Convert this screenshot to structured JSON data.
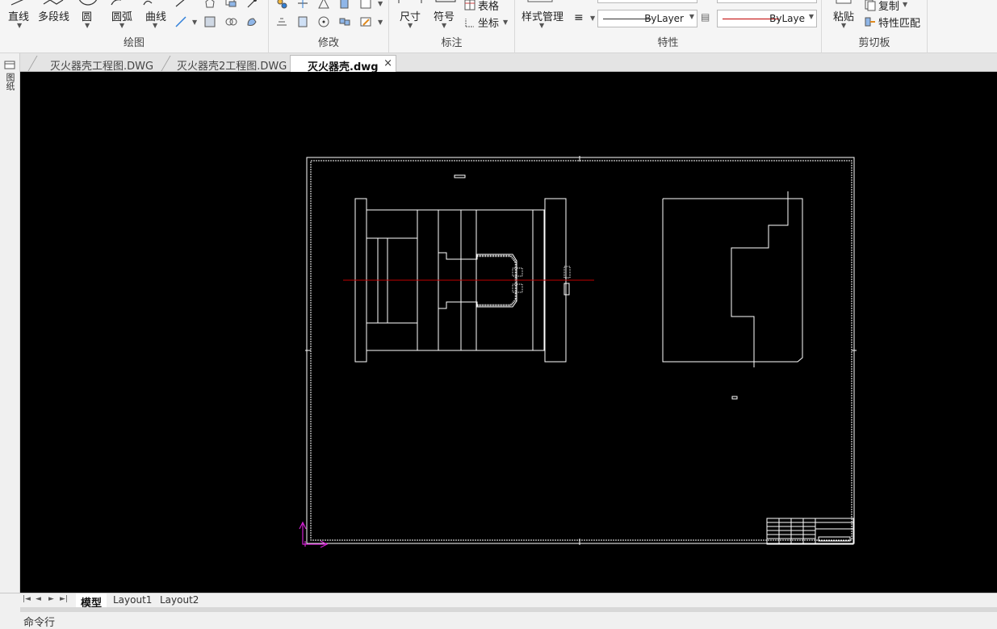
{
  "ribbon": {
    "draw": {
      "title": "绘图",
      "line": "直线",
      "polyline": "多段线",
      "circle": "圆",
      "arc": "圆弧",
      "curve": "曲线"
    },
    "modify": {
      "title": "修改"
    },
    "annotate": {
      "title": "标注",
      "dimension": "尺寸",
      "symbol": "符号",
      "table": "表格",
      "coordinate": "坐标"
    },
    "properties": {
      "title": "特性",
      "style_manager": "样式管理",
      "linetype_value": "ByLayer",
      "color_value": "ByLaye"
    },
    "clipboard": {
      "title": "剪切板",
      "paste": "粘贴",
      "copy": "复制",
      "match_properties": "特性匹配"
    }
  },
  "doc_tabs": [
    {
      "label": "灭火器壳工程图.DWG"
    },
    {
      "label": "灭火器壳2工程图.DWG"
    },
    {
      "label": "灭火器壳.dwg",
      "close": "×"
    }
  ],
  "left_strip": {
    "label": "图纸"
  },
  "layout_tabs": [
    "模型",
    "Layout1",
    "Layout2"
  ],
  "nav_buttons": [
    "|◄",
    "◄",
    "►",
    "►|"
  ],
  "command_line": {
    "label": "命令行"
  },
  "colors": {
    "canvas": "#000000",
    "drawing": "#ffffff",
    "centerline": "#c00000",
    "ucs": "#d020d0",
    "accent_icon": "#2f7fd8"
  }
}
